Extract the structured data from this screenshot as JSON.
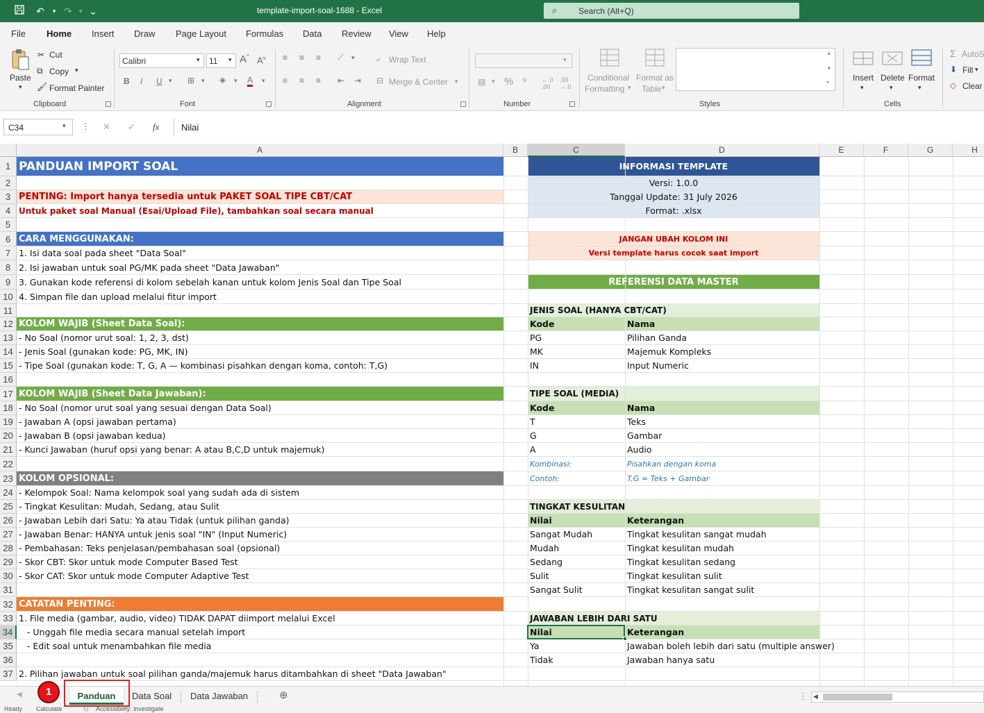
{
  "window": {
    "title": "template-import-soal-1688  -  Excel",
    "search_placeholder": "Search (Alt+Q)"
  },
  "menu": [
    "File",
    "Home",
    "Insert",
    "Draw",
    "Page Layout",
    "Formulas",
    "Data",
    "Review",
    "View",
    "Help"
  ],
  "ribbon": {
    "paste": "Paste",
    "cut": "Cut",
    "copy": "Copy",
    "format_painter": "Format Painter",
    "clipboard": "Clipboard",
    "font_name": "Calibri",
    "font_size": "11",
    "font": "Font",
    "wrap_text": "Wrap Text",
    "merge_center": "Merge & Center",
    "alignment": "Alignment",
    "number": "Number",
    "conditional_formatting": [
      "Conditional",
      "Formatting"
    ],
    "format_as_table": [
      "Format as",
      "Table"
    ],
    "styles": "Styles",
    "insert": "Insert",
    "delete": "Delete",
    "format": "Format",
    "cells": "Cells",
    "autosum": "AutoS",
    "fill": "Fill",
    "clear": "Clear"
  },
  "formula_bar": {
    "name_box": "C34",
    "fx": "fx",
    "value": "Nilai"
  },
  "columns": [
    "A",
    "B",
    "C",
    "D",
    "E",
    "F",
    "G",
    "H"
  ],
  "rows": [
    "1",
    "2",
    "3",
    "4",
    "5",
    "6",
    "7",
    "8",
    "9",
    "10",
    "11",
    "12",
    "13",
    "14",
    "15",
    "16",
    "17",
    "18",
    "19",
    "20",
    "21",
    "22",
    "23",
    "24",
    "25",
    "26",
    "27",
    "28",
    "29",
    "30",
    "31",
    "32",
    "33",
    "34",
    "35",
    "36",
    "37"
  ],
  "col_a": {
    "r1": "PANDUAN IMPORT SOAL",
    "r3": "PENTING: Import hanya tersedia untuk PAKET SOAL TIPE CBT/CAT",
    "r4": "Untuk paket soal Manual (Esai/Upload File), tambahkan soal secara manual",
    "r6": "CARA MENGGUNAKAN:",
    "r7": "1. Isi data soal pada sheet \"Data Soal\"",
    "r8": "2. Isi jawaban untuk soal PG/MK pada sheet \"Data Jawaban\"",
    "r9": "3. Gunakan kode referensi di kolom sebelah kanan untuk kolom Jenis Soal dan Tipe Soal",
    "r10": "4. Simpan file dan upload melalui fitur import",
    "r12": "KOLOM WAJIB (Sheet Data Soal):",
    "r13": "- No Soal (nomor urut soal: 1, 2, 3, dst)",
    "r14": "- Jenis Soal (gunakan kode: PG, MK, IN)",
    "r15": "- Tipe Soal (gunakan kode: T, G, A — kombinasi pisahkan dengan koma, contoh: T,G)",
    "r17": "KOLOM WAJIB (Sheet Data Jawaban):",
    "r18": "- No Soal (nomor urut soal yang sesuai dengan Data Soal)",
    "r19": "- Jawaban A (opsi jawaban pertama)",
    "r20": "- Jawaban B (opsi jawaban kedua)",
    "r21": "- Kunci Jawaban (huruf opsi yang benar: A atau B,C,D untuk majemuk)",
    "r23": "KOLOM OPSIONAL:",
    "r24": "- Kelompok Soal: Nama kelompok soal yang sudah ada di sistem",
    "r25": "- Tingkat Kesulitan: Mudah, Sedang, atau Sulit",
    "r26": "- Jawaban Lebih dari Satu: Ya atau Tidak (untuk pilihan ganda)",
    "r27": "- Jawaban Benar: HANYA untuk jenis soal \"IN\" (Input Numeric)",
    "r28": "- Pembahasan: Teks penjelasan/pembahasan soal (opsional)",
    "r29": "- Skor CBT: Skor untuk mode Computer Based Test",
    "r30": "- Skor CAT: Skor untuk mode Computer Adaptive Test",
    "r32": "CATATAN PENTING:",
    "r33": "1. File media (gambar, audio, video) TIDAK DAPAT diimport melalui Excel",
    "r34": "   - Unggah file media secara manual setelah import",
    "r35": "   - Edit soal untuk menambahkan file media",
    "r37": "2. Pilihan jawaban untuk soal pilihan ganda/majemuk harus ditambahkan di sheet \"Data Jawaban\""
  },
  "info": {
    "title": "INFORMASI TEMPLATE",
    "version": "Versi: 1.0.0",
    "date": "Tanggal Update: 31 July 2026",
    "format": "Format: .xlsx",
    "warn1": "JANGAN UBAH KOLOM INI",
    "warn2": "Versi template harus cocok saat import",
    "ref_title": "REFERENSI DATA MASTER"
  },
  "jenis": {
    "title": "JENIS SOAL (HANYA CBT/CAT)",
    "header": [
      "Kode",
      "Nama"
    ],
    "rows": [
      [
        "PG",
        "Pilihan Ganda"
      ],
      [
        "MK",
        "Majemuk Kompleks"
      ],
      [
        "IN",
        "Input Numeric"
      ]
    ]
  },
  "tipe": {
    "title": "TIPE SOAL (MEDIA)",
    "header": [
      "Kode",
      "Nama"
    ],
    "rows": [
      [
        "T",
        "Teks"
      ],
      [
        "G",
        "Gambar"
      ],
      [
        "A",
        "Audio"
      ]
    ],
    "note1": [
      "Kombinasi:",
      "Pisahkan dengan koma"
    ],
    "note2": [
      "Contoh:",
      "T,G = Teks + Gambar"
    ]
  },
  "tingkat": {
    "title": "TINGKAT KESULITAN",
    "header": [
      "Nilai",
      "Keterangan"
    ],
    "rows": [
      [
        "Sangat Mudah",
        "Tingkat kesulitan sangat mudah"
      ],
      [
        "Mudah",
        "Tingkat kesulitan mudah"
      ],
      [
        "Sedang",
        "Tingkat kesulitan sedang"
      ],
      [
        "Sulit",
        "Tingkat kesulitan sulit"
      ],
      [
        "Sangat Sulit",
        "Tingkat kesulitan sangat sulit"
      ]
    ]
  },
  "jawaban": {
    "title": "JAWABAN LEBIH DARI SATU",
    "header": [
      "Nilai",
      "Keterangan"
    ],
    "rows": [
      [
        "Ya",
        "Jawaban boleh lebih dari satu (multiple answer)"
      ],
      [
        "Tidak",
        "Jawaban hanya satu"
      ]
    ]
  },
  "sheets": [
    "Panduan",
    "Data Soal",
    "Data Jawaban"
  ],
  "badge": "1",
  "status": {
    "ready": "Ready",
    "calc": "Calculate",
    "access": "Accessibility: Investigate"
  },
  "colors": {
    "excel_green": "#217346",
    "blue_header": "#4472c4",
    "dark_blue": "#2f5597",
    "green_header": "#70ad47",
    "gray_header": "#808080",
    "orange_header": "#ed7d31",
    "pink_fill": "#fce4d6",
    "light_blue": "#dde7f1",
    "light_green": "#e2efda",
    "mid_green": "#c6e0b4",
    "red_text": "#c00000"
  }
}
